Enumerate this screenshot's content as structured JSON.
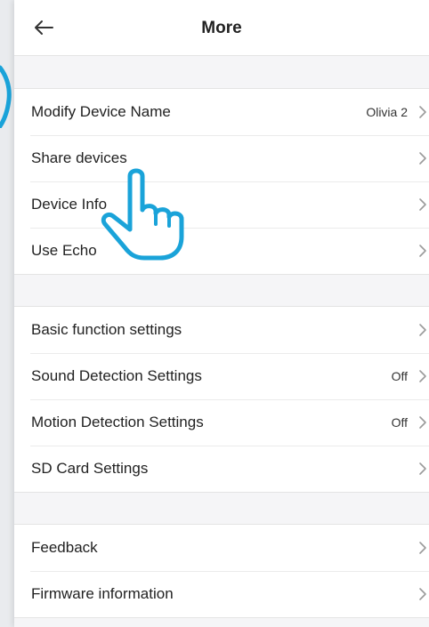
{
  "header": {
    "title": "More",
    "back_icon": "arrow-left-icon"
  },
  "groups": [
    {
      "items": [
        {
          "label": "Modify Device Name",
          "value": "Olivia 2"
        },
        {
          "label": "Share devices",
          "value": ""
        },
        {
          "label": "Device Info",
          "value": ""
        },
        {
          "label": "Use Echo",
          "value": ""
        }
      ]
    },
    {
      "items": [
        {
          "label": "Basic function settings",
          "value": ""
        },
        {
          "label": "Sound Detection Settings",
          "value": "Off"
        },
        {
          "label": "Motion Detection Settings",
          "value": "Off"
        },
        {
          "label": "SD Card Settings",
          "value": ""
        }
      ]
    },
    {
      "items": [
        {
          "label": "Feedback",
          "value": ""
        },
        {
          "label": "Firmware information",
          "value": ""
        }
      ]
    }
  ],
  "overlay": {
    "pointer_icon": "pointing-hand-icon"
  },
  "colors": {
    "background": "#f5f5f7",
    "row_background": "#ffffff",
    "text": "#222222",
    "chevron": "#9a9a9a",
    "hand_outline": "#1aa3d9"
  }
}
